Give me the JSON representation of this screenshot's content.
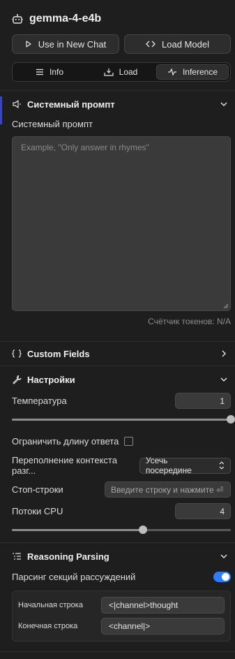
{
  "header": {
    "model_name": "gemma-4-e4b",
    "use_in_new_chat": "Use in New Chat",
    "load_model": "Load Model"
  },
  "tabs": [
    {
      "label": "Info",
      "icon": "list-icon"
    },
    {
      "label": "Load",
      "icon": "load-icon"
    },
    {
      "label": "Inference",
      "icon": "pulse-icon",
      "active": true
    }
  ],
  "system_prompt": {
    "section_title": "Системный промпт",
    "field_label": "Системный промпт",
    "placeholder": "Example, \"Only answer in rhymes\"",
    "token_counter": "Счётчик токенов: N/A"
  },
  "custom_fields": {
    "section_title": "Custom Fields"
  },
  "settings": {
    "section_title": "Настройки",
    "temperature_label": "Температура",
    "temperature_value": "1",
    "temperature_fraction": 1.0,
    "limit_length_label": "Ограничить длину ответа",
    "overflow_label": "Переполнение контекста разг...",
    "overflow_value": "Усечь посередине",
    "stop_strings_label": "Стоп-строки",
    "stop_strings_placeholder": "Введите строку и нажмите ⏎",
    "cpu_threads_label": "Потоки CPU",
    "cpu_threads_value": "4",
    "cpu_threads_fraction": 0.6
  },
  "reasoning": {
    "section_title": "Reasoning Parsing",
    "parse_label": "Парсинг секций рассуждений",
    "parse_enabled": true,
    "start_label": "Начальная строка",
    "start_value": "<|channel>thought",
    "end_label": "Конечная строка",
    "end_value": "<channel|>"
  },
  "colors": {
    "background": "#1e1e1e",
    "accent": "#2f7cf6",
    "sidebar_indicator": "#3b45b8"
  }
}
